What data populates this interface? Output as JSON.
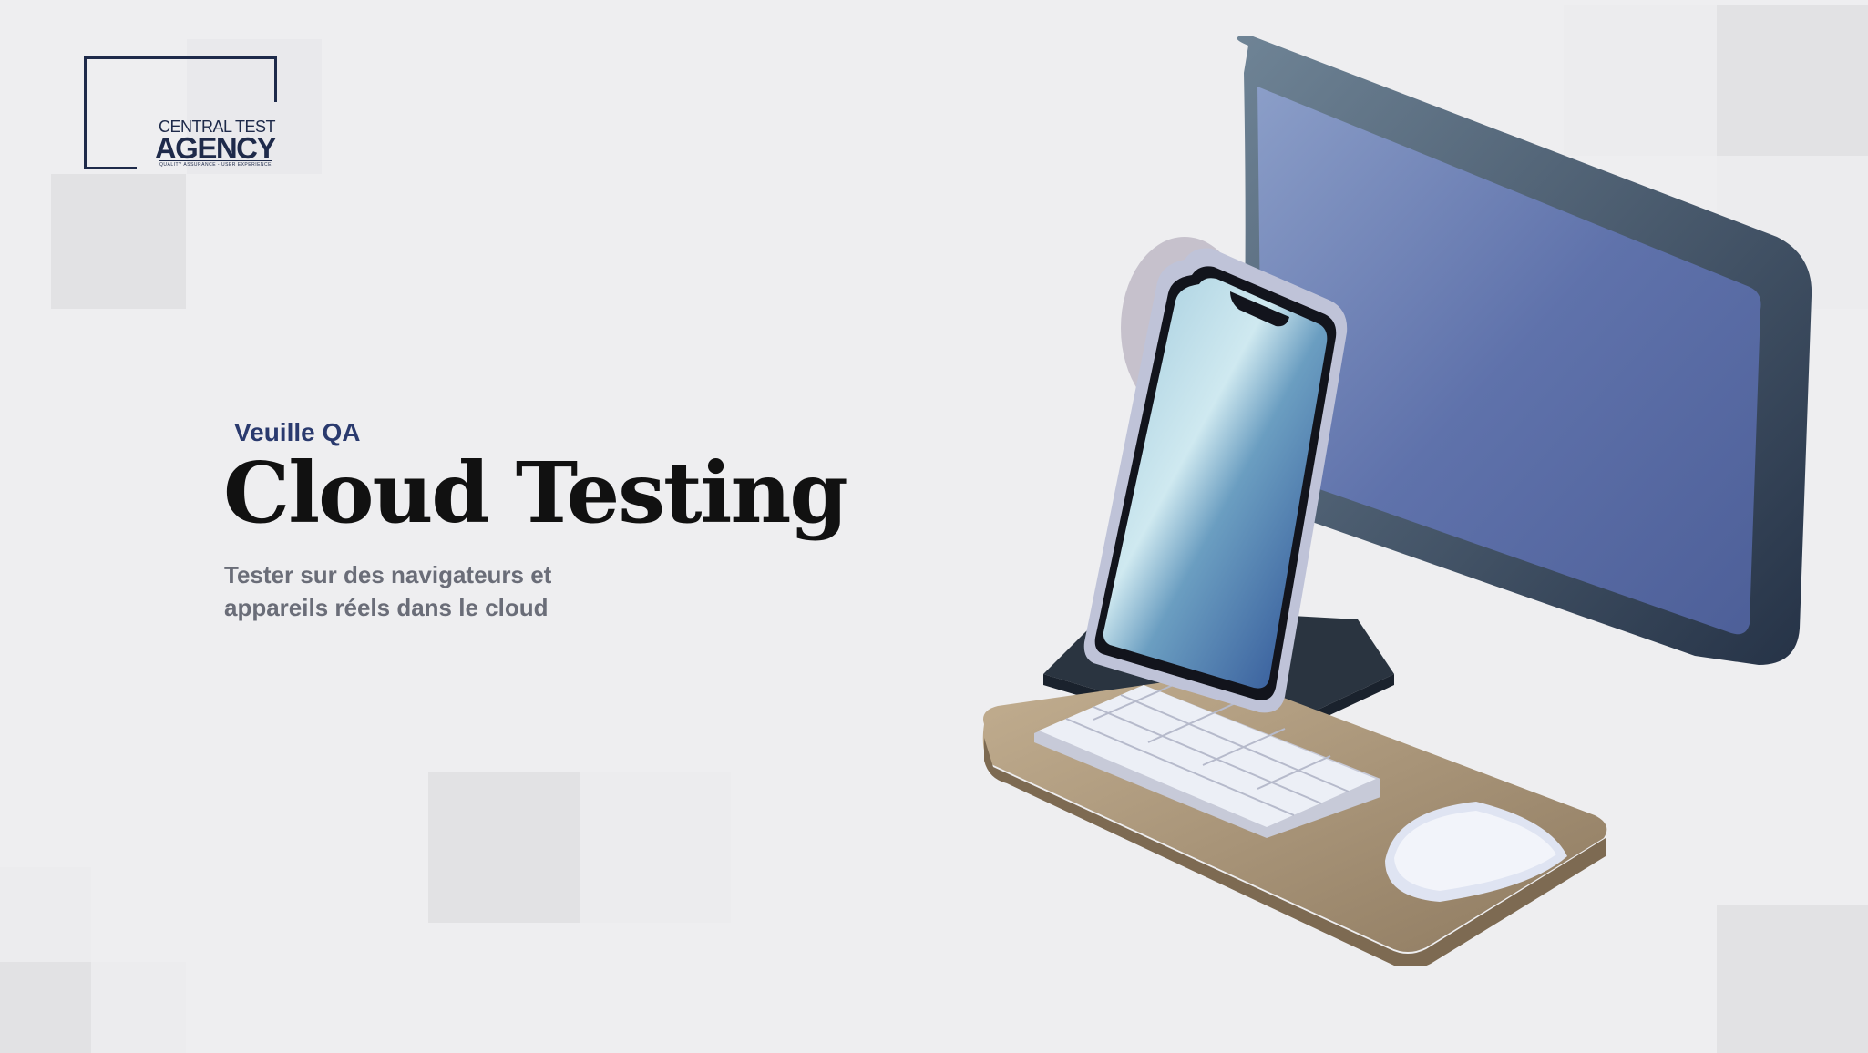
{
  "logo": {
    "line1": "CENTRAL TEST",
    "line2": "AGENCY",
    "line3": "QUALITY ASSURANCE - USER EXPERIENCE"
  },
  "hero": {
    "kicker": "Veuille QA",
    "title": "Cloud Testing",
    "subtitle_line1": "Tester sur des navigateurs et",
    "subtitle_line2": "appareils réels dans le cloud"
  },
  "colors": {
    "background": "#eeeef0",
    "brand_navy": "#1e2a4a",
    "kicker": "#2a3a6e",
    "title": "#111111",
    "subtitle": "#6a6d78"
  },
  "illustration": {
    "icons": [
      "monitor-icon",
      "smartphone-icon",
      "keyboard-icon",
      "mouse-icon",
      "desk-tray-icon"
    ]
  }
}
